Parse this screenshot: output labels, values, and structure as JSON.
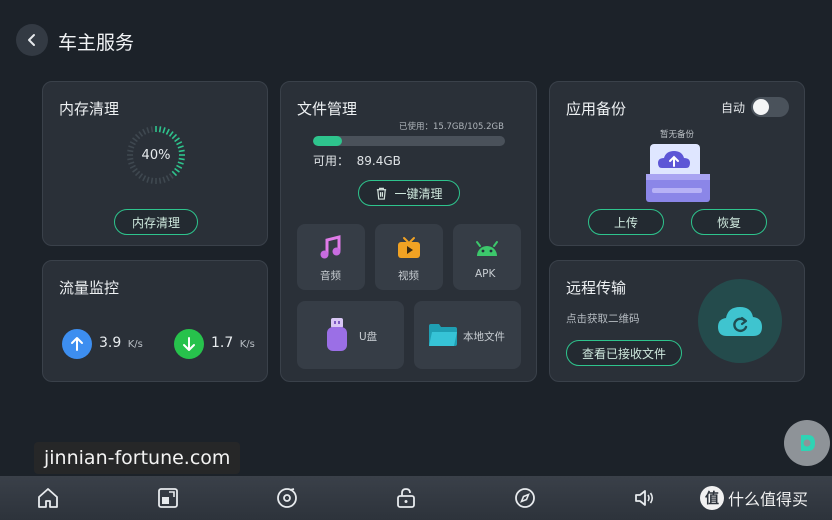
{
  "header": {
    "title": "车主服务"
  },
  "memory": {
    "title": "内存清理",
    "percent_text": "40%",
    "percent": 40,
    "button": "内存清理"
  },
  "traffic": {
    "title": "流量监控",
    "upload_value": "3.9",
    "upload_unit": "K/s",
    "download_value": "1.7",
    "download_unit": "K/s"
  },
  "files": {
    "title": "文件管理",
    "usage_text": "已使用：15.7GB/105.2GB",
    "used_fraction": 0.149,
    "available_text": "可用：  89.4GB",
    "clean_button": "一键清理",
    "tiles": {
      "audio": "音频",
      "video": "视频",
      "apk": "APK",
      "usb": "U盘",
      "local": "本地文件"
    }
  },
  "backup": {
    "title": "应用备份",
    "auto_label": "自动",
    "auto_enabled": false,
    "empty_text": "暂无备份",
    "upload_button": "上传",
    "restore_button": "恢复"
  },
  "remote": {
    "title": "远程传输",
    "hint": "点击获取二维码",
    "view_button": "查看已接收文件"
  },
  "watermarks": {
    "site": "jinnian-fortune.com",
    "brand": "什么值得买"
  },
  "colors": {
    "accent": "#2ec48d",
    "upload": "#3d8ef0",
    "download": "#27c24c",
    "background": "#1c2229",
    "card": "#2a3038"
  },
  "navbar": {
    "icons": [
      "home-icon",
      "window-icon",
      "music-disc-icon",
      "lock-icon",
      "compass-icon",
      "volume-icon",
      "user-icon"
    ]
  }
}
